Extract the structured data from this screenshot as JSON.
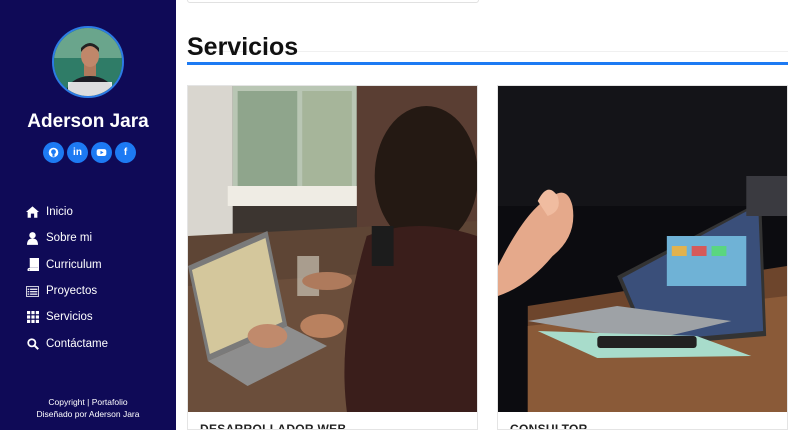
{
  "profile": {
    "name": "Aderson Jara",
    "socials": [
      {
        "icon": "github-icon",
        "glyph": "◉"
      },
      {
        "icon": "linkedin-icon",
        "glyph": "in"
      },
      {
        "icon": "youtube-icon",
        "glyph": "▶"
      },
      {
        "icon": "facebook-icon",
        "glyph": "f"
      }
    ]
  },
  "nav": {
    "items": [
      {
        "label": "Inicio",
        "icon": "home-icon"
      },
      {
        "label": "Sobre mi",
        "icon": "user-icon"
      },
      {
        "label": "Curriculum",
        "icon": "book-icon"
      },
      {
        "label": "Proyectos",
        "icon": "list-icon"
      },
      {
        "label": "Servicios",
        "icon": "grid-icon"
      },
      {
        "label": "Contáctame",
        "icon": "search-icon"
      }
    ]
  },
  "footer": {
    "line1": "Copyright | Portafolio",
    "line2": "Diseñado por Aderson Jara"
  },
  "section": {
    "title": "Servicios"
  },
  "cards": [
    {
      "title": "DESARROLLADOR WEB"
    },
    {
      "title": "CONSULTOR"
    }
  ],
  "colors": {
    "sidebar": "#0f0a57",
    "accent": "#1d7af3"
  }
}
